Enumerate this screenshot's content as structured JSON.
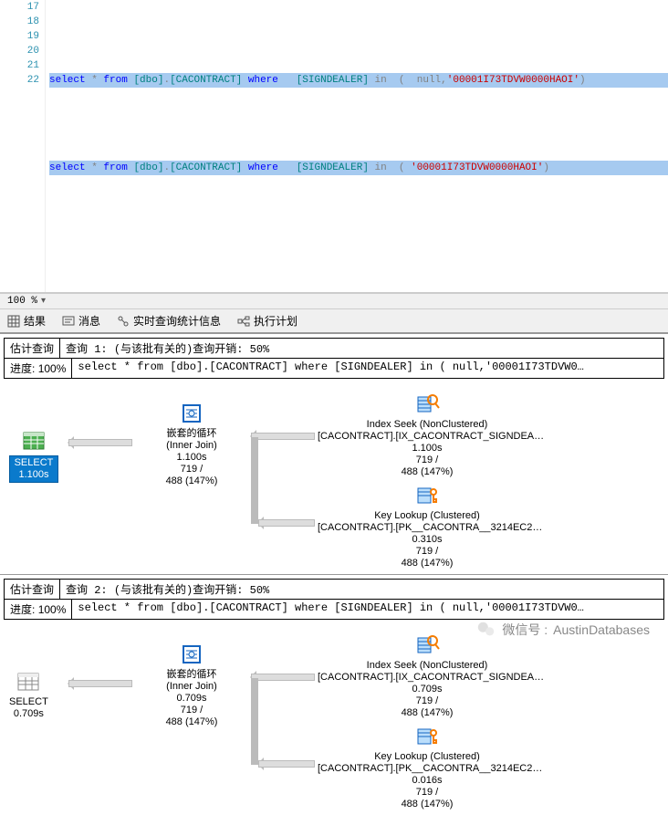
{
  "editor": {
    "line_numbers": [
      "17",
      "18",
      "19",
      "20",
      "21",
      "22"
    ],
    "lines": {
      "l18_select": "select",
      "l18_star": " * ",
      "l18_from": "from ",
      "l18_schema": "[dbo]",
      "l18_dot": ".",
      "l18_table": "[CACONTRACT]",
      "l18_where": " where   ",
      "l18_col": "[SIGNDEALER]",
      "l18_in": " in ",
      "l18_paren": " ( ",
      "l18_null": " null",
      "l18_comma": ",",
      "l18_str": "'00001I73TDVW0000HAOI'",
      "l18_close": ")",
      "l20_select": "select",
      "l20_star": " * ",
      "l20_from": "from ",
      "l20_schema": "[dbo]",
      "l20_dot": ".",
      "l20_table": "[CACONTRACT]",
      "l20_where": " where   ",
      "l20_col": "[SIGNDEALER]",
      "l20_in": " in ",
      "l20_paren": " (",
      "l20_str": " '00001I73TDVW0000HAOI'",
      "l20_close": ")"
    }
  },
  "zoom": "100 %",
  "tabs": {
    "results": "结果",
    "messages": "消息",
    "live_stats": "实时查询统计信息",
    "exec_plan": "执行计划"
  },
  "labels": {
    "est_query": "估计查询",
    "progress_label": "进度:",
    "progress_value": "100%",
    "q1_header": "查询 1: (与该批有关的)查询开销: 50%",
    "q2_header": "查询 2: (与该批有关的)查询开销: 50%",
    "sql_text": "select * from [dbo].[CACONTRACT] where [SIGNDEALER] in ( null,'00001I73TDVW0…"
  },
  "plan1": {
    "select_label": "SELECT",
    "select_time": "1.100s",
    "loop_title": "嵌套的循环",
    "loop_join": "(Inner Join)",
    "loop_time": "1.100s",
    "rows_a": "719 /",
    "rows_b": "488 (147%)",
    "seek_title": "Index Seek (NonClustered)",
    "seek_source": "[CACONTRACT].[IX_CACONTRACT_SIGNDEA…",
    "seek_time": "1.100s",
    "lookup_title": "Key Lookup (Clustered)",
    "lookup_source": "[CACONTRACT].[PK__CACONTRA__3214EC2…",
    "lookup_time": "0.310s"
  },
  "plan2": {
    "select_label": "SELECT",
    "select_time": "0.709s",
    "loop_title": "嵌套的循环",
    "loop_join": "(Inner Join)",
    "loop_time": "0.709s",
    "rows_a": "719 /",
    "rows_b": "488 (147%)",
    "seek_title": "Index Seek (NonClustered)",
    "seek_source": "[CACONTRACT].[IX_CACONTRACT_SIGNDEA…",
    "seek_time": "0.709s",
    "lookup_title": "Key Lookup (Clustered)",
    "lookup_source": "[CACONTRACT].[PK__CACONTRA__3214EC2…",
    "lookup_time": "0.016s"
  },
  "watermark": {
    "prefix": "微信号 :",
    "name": "AustinDatabases"
  }
}
